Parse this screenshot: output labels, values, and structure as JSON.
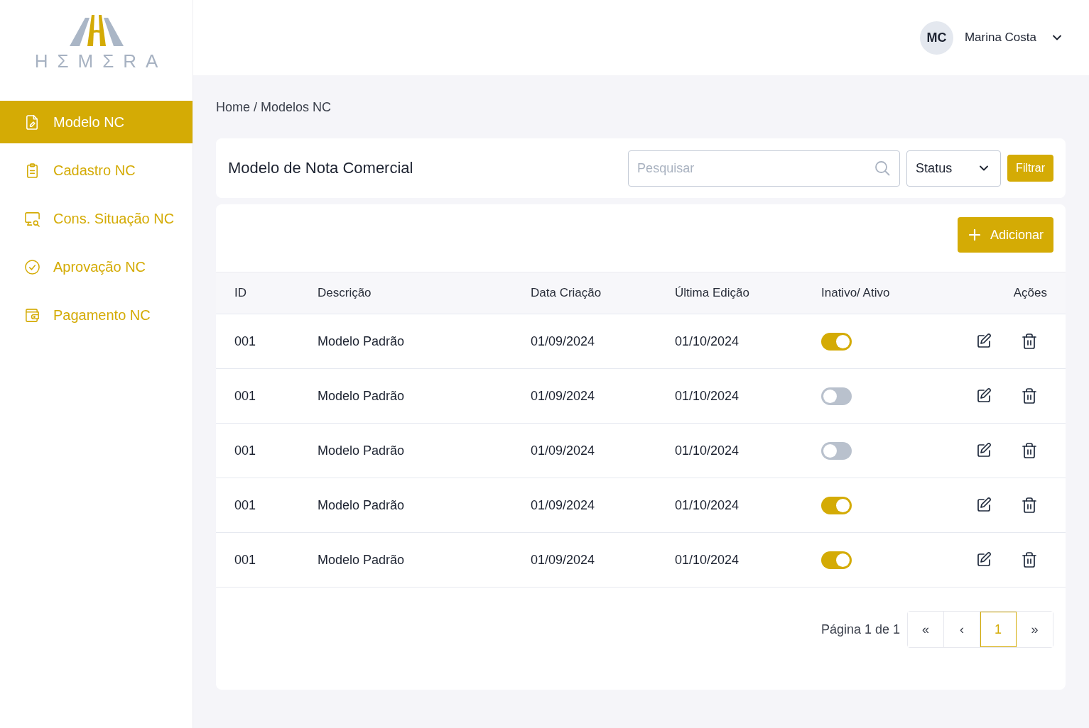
{
  "sidebar": {
    "logo": {
      "wordmark": "HΣMΣRA"
    },
    "items": [
      {
        "label": "Modelo NC",
        "selected": true
      },
      {
        "label": "Cadastro NC",
        "selected": false
      },
      {
        "label": "Cons. Situação NC",
        "selected": false
      },
      {
        "label": "Aprovação NC",
        "selected": false
      },
      {
        "label": "Pagamento NC",
        "selected": false
      }
    ]
  },
  "header": {
    "user": {
      "initials": "MC",
      "name": "Marina Costa"
    }
  },
  "breadcrumb": "Home / Modelos NC",
  "filter_bar": {
    "title": "Modelo de Nota Comercial",
    "search": {
      "placeholder": "Pesquisar"
    },
    "status_select": {
      "value": "Status"
    },
    "filter_button": "Filtrar"
  },
  "add_button": "Adicionar",
  "table": {
    "columns": [
      "ID",
      "Descrição",
      "Data Criação",
      "Última Edição",
      "Inativo/ Ativo",
      "Ações"
    ],
    "rows": [
      {
        "id": "001",
        "description": "Modelo Padrão",
        "created": "01/09/2024",
        "edited": "01/10/2024",
        "active": true
      },
      {
        "id": "001",
        "description": "Modelo Padrão",
        "created": "01/09/2024",
        "edited": "01/10/2024",
        "active": false
      },
      {
        "id": "001",
        "description": "Modelo Padrão",
        "created": "01/09/2024",
        "edited": "01/10/2024",
        "active": false
      },
      {
        "id": "001",
        "description": "Modelo Padrão",
        "created": "01/09/2024",
        "edited": "01/10/2024",
        "active": true
      },
      {
        "id": "001",
        "description": "Modelo Padrão",
        "created": "01/09/2024",
        "edited": "01/10/2024",
        "active": true
      }
    ]
  },
  "pagination": {
    "summary": "Página 1 de 1",
    "buttons": [
      {
        "label": "«",
        "selected": false
      },
      {
        "label": "‹",
        "selected": false
      },
      {
        "label": "1",
        "selected": true
      },
      {
        "label": "»",
        "selected": false
      }
    ]
  }
}
